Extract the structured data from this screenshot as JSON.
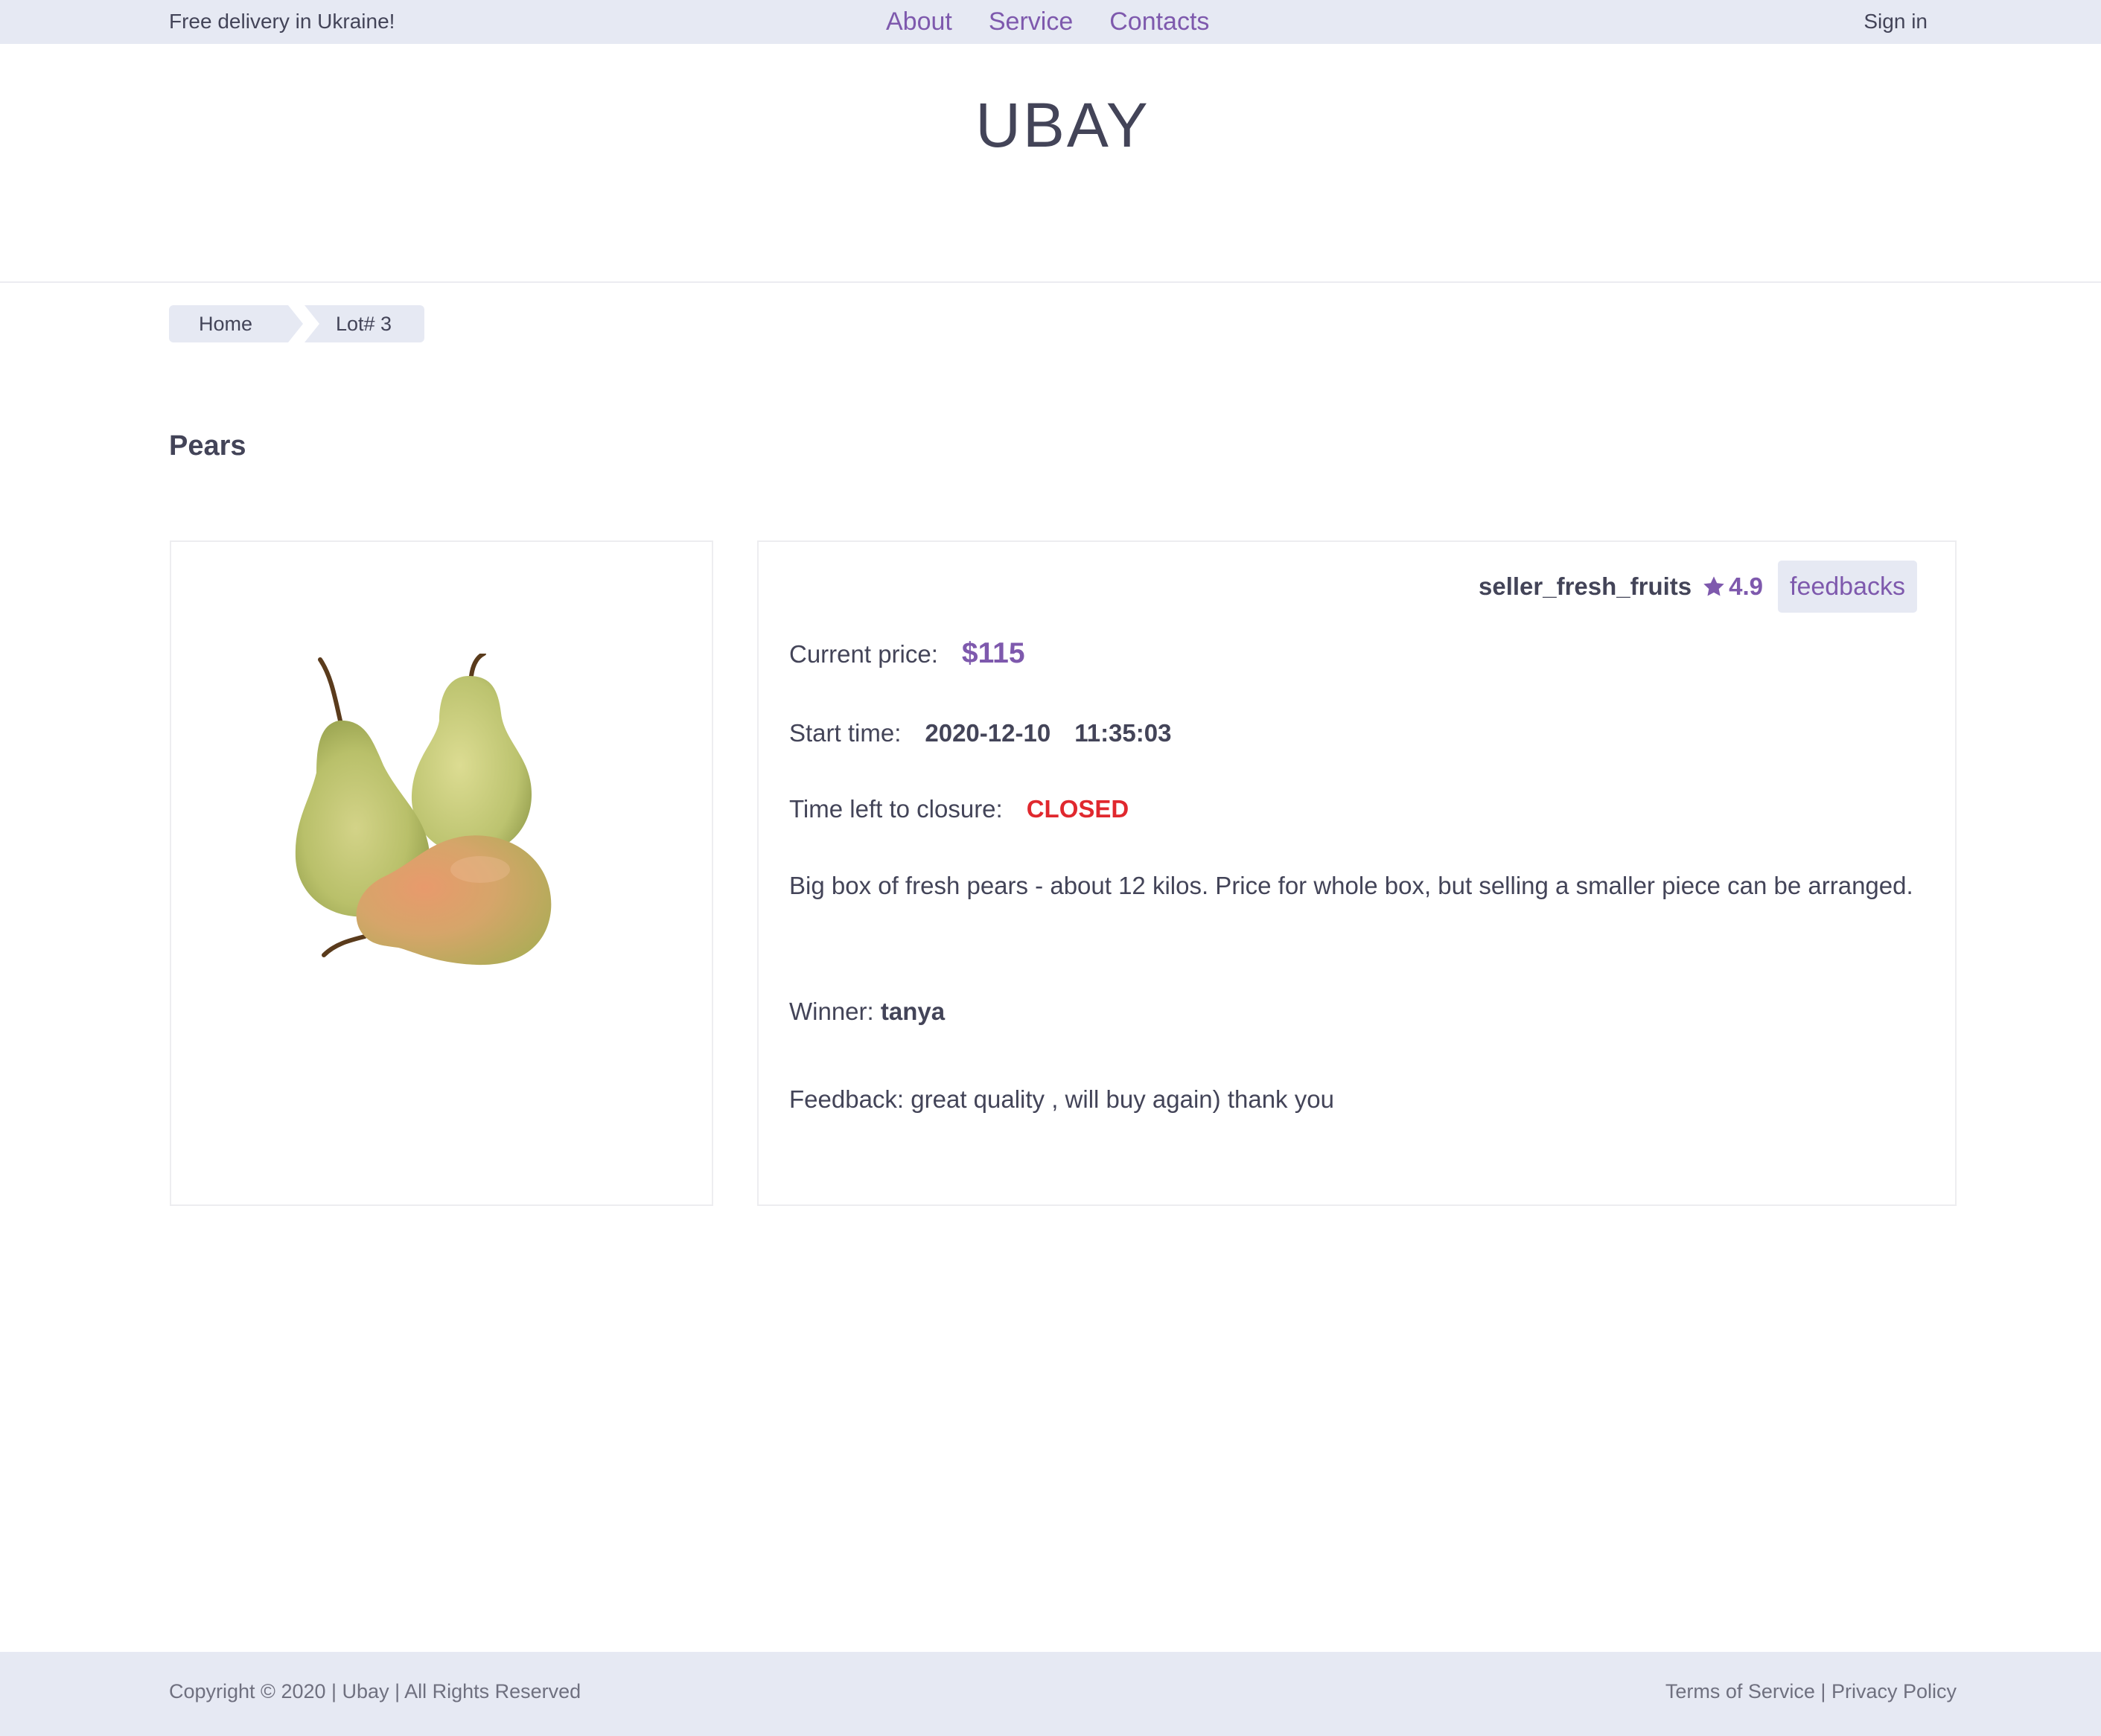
{
  "topbar": {
    "promo": "Free delivery in Ukraine!",
    "nav": [
      "About",
      "Service",
      "Contacts"
    ],
    "sign_in": "Sign in"
  },
  "logo": "UBAY",
  "breadcrumb": [
    "Home",
    "Lot# 3"
  ],
  "lot": {
    "title": "Pears",
    "seller": "seller_fresh_fruits",
    "rating": "4.9",
    "feedbacks_label": "feedbacks",
    "current_price_label": "Current price:",
    "current_price": "$115",
    "start_time_label": "Start time:",
    "start_date": "2020-12-10",
    "start_clock": "11:35:03",
    "time_left_label": "Time left to closure:",
    "status": "CLOSED",
    "description": "Big box of fresh pears - about 12 kilos. Price for whole box, but selling a smaller piece can be arranged.",
    "winner_label": "Winner:",
    "winner": "tanya",
    "feedback_label": "Feedback:",
    "feedback": "great quality , will buy again) thank you"
  },
  "footer": {
    "copyright": "Copyright © 2020 | Ubay | All Rights Reserved",
    "terms": "Terms of Service",
    "separator": "|",
    "privacy": "Privacy Policy"
  },
  "colors": {
    "accent": "#7e59ad",
    "text": "#434458",
    "bar_bg": "#e6e9f3",
    "closed": "#e0282e"
  }
}
